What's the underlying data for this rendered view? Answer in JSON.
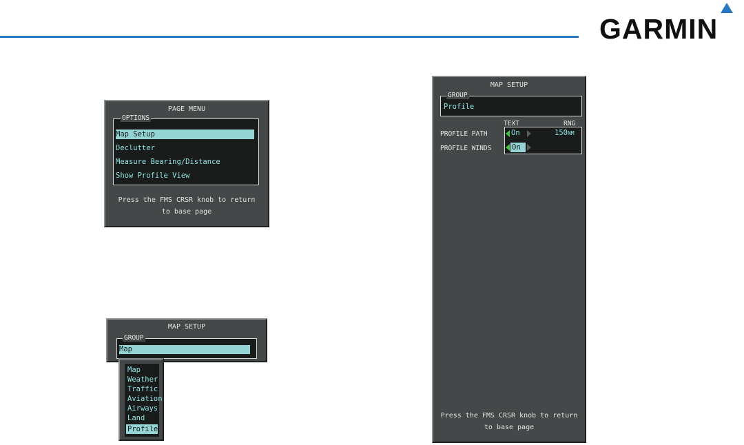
{
  "brand": {
    "logo": "GARMIN"
  },
  "page_menu": {
    "title": "PAGE MENU",
    "group_label": "OPTIONS",
    "items": [
      "Map Setup",
      "Declutter",
      "Measure Bearing/Distance",
      "Show Profile View"
    ],
    "selected_index": 0,
    "footer_line1": "Press the FMS CRSR knob to return",
    "footer_line2": "to base page"
  },
  "map_setup_small": {
    "title": "MAP SETUP",
    "group_label": "GROUP",
    "group_value": "Map",
    "dropdown": [
      "Map",
      "Weather",
      "Traffic",
      "Aviation",
      "Airways",
      "Land",
      "Profile"
    ],
    "selected_index": 6
  },
  "map_setup_large": {
    "title": "MAP SETUP",
    "group_label": "GROUP",
    "group_value": "Profile",
    "col_text": "TEXT",
    "col_rng": "RNG",
    "rows": [
      {
        "label": "PROFILE PATH",
        "value": "On",
        "range": "150",
        "range_unit": "NM"
      },
      {
        "label": "PROFILE WINDS",
        "value": "On"
      }
    ],
    "footer_line1": "Press the FMS CRSR knob to return",
    "footer_line2": "to base page"
  },
  "colors": {
    "accent": "#2b78c2",
    "panel": "#454848",
    "highlight": "#95d4d4",
    "text_cyan": "#8fe3e3",
    "arrow_active": "#42c242"
  }
}
